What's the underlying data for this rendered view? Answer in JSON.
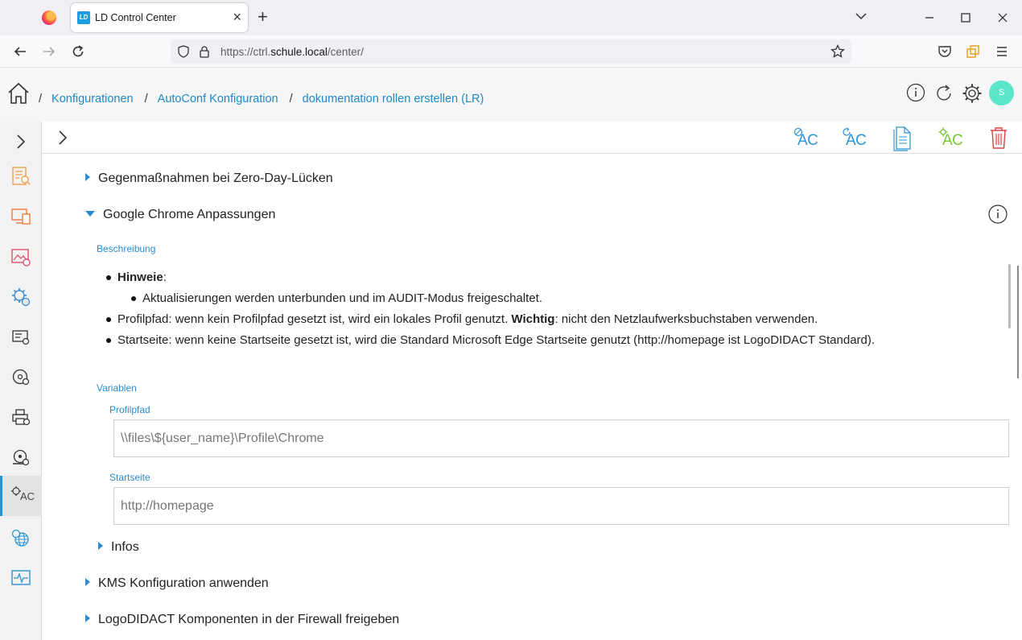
{
  "browser": {
    "tab_title": "LD Control Center",
    "tab_favicon_text": "LD",
    "url_prefix": "https://ctrl.",
    "url_host": "schule.local",
    "url_path": "/center/"
  },
  "header": {
    "breadcrumbs": [
      "Konfigurationen",
      "AutoConf Konfiguration",
      "dokumentation rollen erstellen (LR)"
    ],
    "avatar_initial": "S",
    "icons": [
      "info-icon",
      "refresh-icon",
      "settings-gear-icon"
    ]
  },
  "sidebar": {
    "items": [
      {
        "icon": "report-icon",
        "color": "#f0a050"
      },
      {
        "icon": "devices-icon",
        "color": "#f07a3c"
      },
      {
        "icon": "image-settings-icon",
        "color": "#e0506a"
      },
      {
        "icon": "config-gears-icon",
        "color": "#3a8fd0"
      },
      {
        "icon": "hardware-icon",
        "color": "#333333"
      },
      {
        "icon": "disc-icon",
        "color": "#333333"
      },
      {
        "icon": "printer-icon",
        "color": "#333333"
      },
      {
        "icon": "hdd-icon",
        "color": "#333333"
      },
      {
        "icon": "autoconf-icon",
        "label": "AC",
        "active": true
      },
      {
        "icon": "globe-gear-icon",
        "color": "#2e95d3"
      },
      {
        "icon": "monitor-pulse-icon",
        "color": "#2e95d3"
      }
    ]
  },
  "toolbar": {
    "ac_label": "AC",
    "actions": [
      "ac-disable-button",
      "ac-reset-button",
      "document-button",
      "ac-apply-button",
      "delete-button"
    ]
  },
  "sections": {
    "zero_day": "Gegenmaßnahmen bei Zero-Day-Lücken",
    "chrome": "Google Chrome Anpassungen",
    "infos": "Infos",
    "kms": "KMS Konfiguration anwenden",
    "firewall": "LogoDIDACT Komponenten in der Firewall freigeben"
  },
  "chrome_section": {
    "description_label": "Beschreibung",
    "hint_title": "Hinweie",
    "hint_colon": ":",
    "hint_sub": "Aktualisierungen werden unterbunden und im AUDIT-Modus freigeschaltet.",
    "profile_text_a": "Profilpfad: wenn kein Profilpfad gesetzt ist, wird ein lokales Profil genutzt. ",
    "profile_bold": "Wichtig",
    "profile_text_b": ": nicht den Netzlaufwerksbuchstaben verwenden.",
    "startpage_text": "Startseite: wenn keine Startseite gesetzt ist, wird die Standard Microsoft Edge Startseite genutzt (http://homepage ist LogoDIDACT Standard).",
    "variables_label": "Variablen",
    "profile_field_label": "Profilpfad",
    "profile_field_value": "\\\\files\\${user_name}\\Profile\\Chrome",
    "startpage_field_label": "Startseite",
    "startpage_field_placeholder": "http://homepage"
  }
}
